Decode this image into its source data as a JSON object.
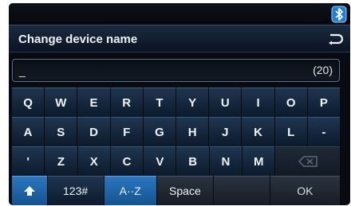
{
  "status": {
    "icon": "bluetooth-icon"
  },
  "header": {
    "title": "Change device name",
    "back_icon": "return-arrow-icon"
  },
  "input": {
    "value": "_",
    "counter": "(20)"
  },
  "keyboard": {
    "row1": [
      "Q",
      "W",
      "E",
      "R",
      "T",
      "Y",
      "U",
      "I",
      "O",
      "P"
    ],
    "row2": [
      "A",
      "S",
      "D",
      "F",
      "G",
      "H",
      "J",
      "K",
      "L",
      "-"
    ],
    "row3": [
      "'",
      "Z",
      "X",
      "C",
      "V",
      "B",
      "N",
      "M"
    ],
    "row4": {
      "shift_icon": "shift-arrow-icon",
      "numeric": "123#",
      "alpha": "A··Z",
      "space": "Space",
      "ok": "OK"
    },
    "backspace_icon": "backspace-icon"
  }
}
